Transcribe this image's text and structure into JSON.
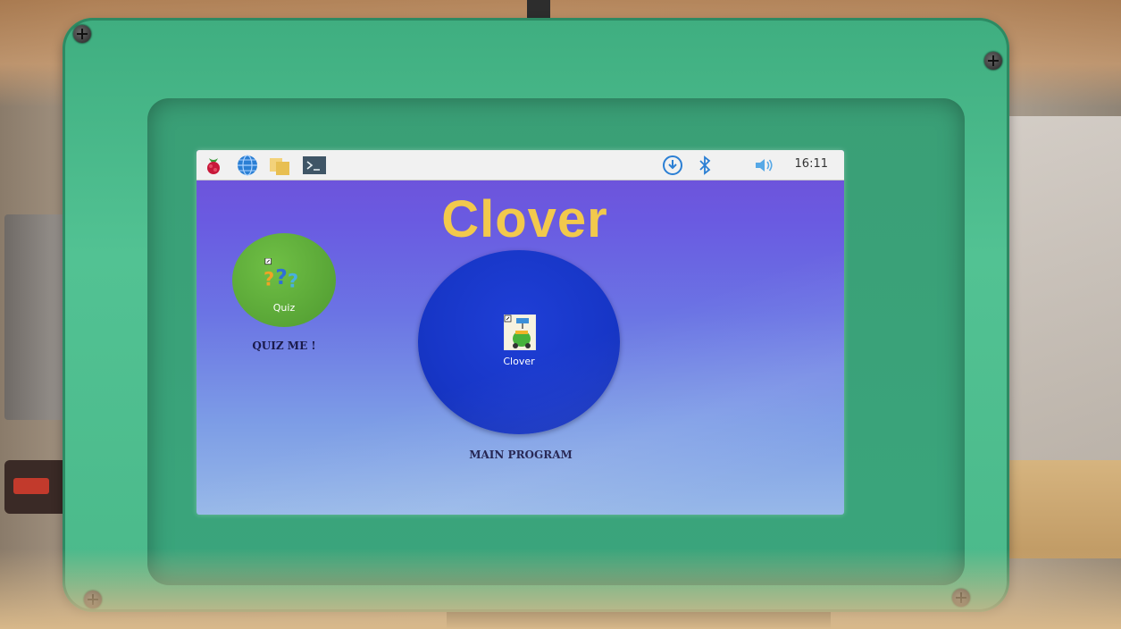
{
  "taskbar": {
    "clock": "16:11",
    "icons": [
      "raspberry-pi-menu-icon",
      "web-browser-globe-icon",
      "file-manager-folders-icon",
      "terminal-icon",
      "download-update-icon",
      "bluetooth-icon",
      "volume-icon"
    ]
  },
  "desktop": {
    "title": "Clover",
    "quiz": {
      "icon_label": "Quiz",
      "caption": "QUIZ ME !"
    },
    "main_program": {
      "icon_label": "Clover",
      "caption": "MAIN PROGRAM"
    }
  },
  "colors": {
    "title": "#f2c94c",
    "quiz_circle": "#5fae3a",
    "main_circle": "#1a3acd",
    "case": "#4ab98a"
  }
}
